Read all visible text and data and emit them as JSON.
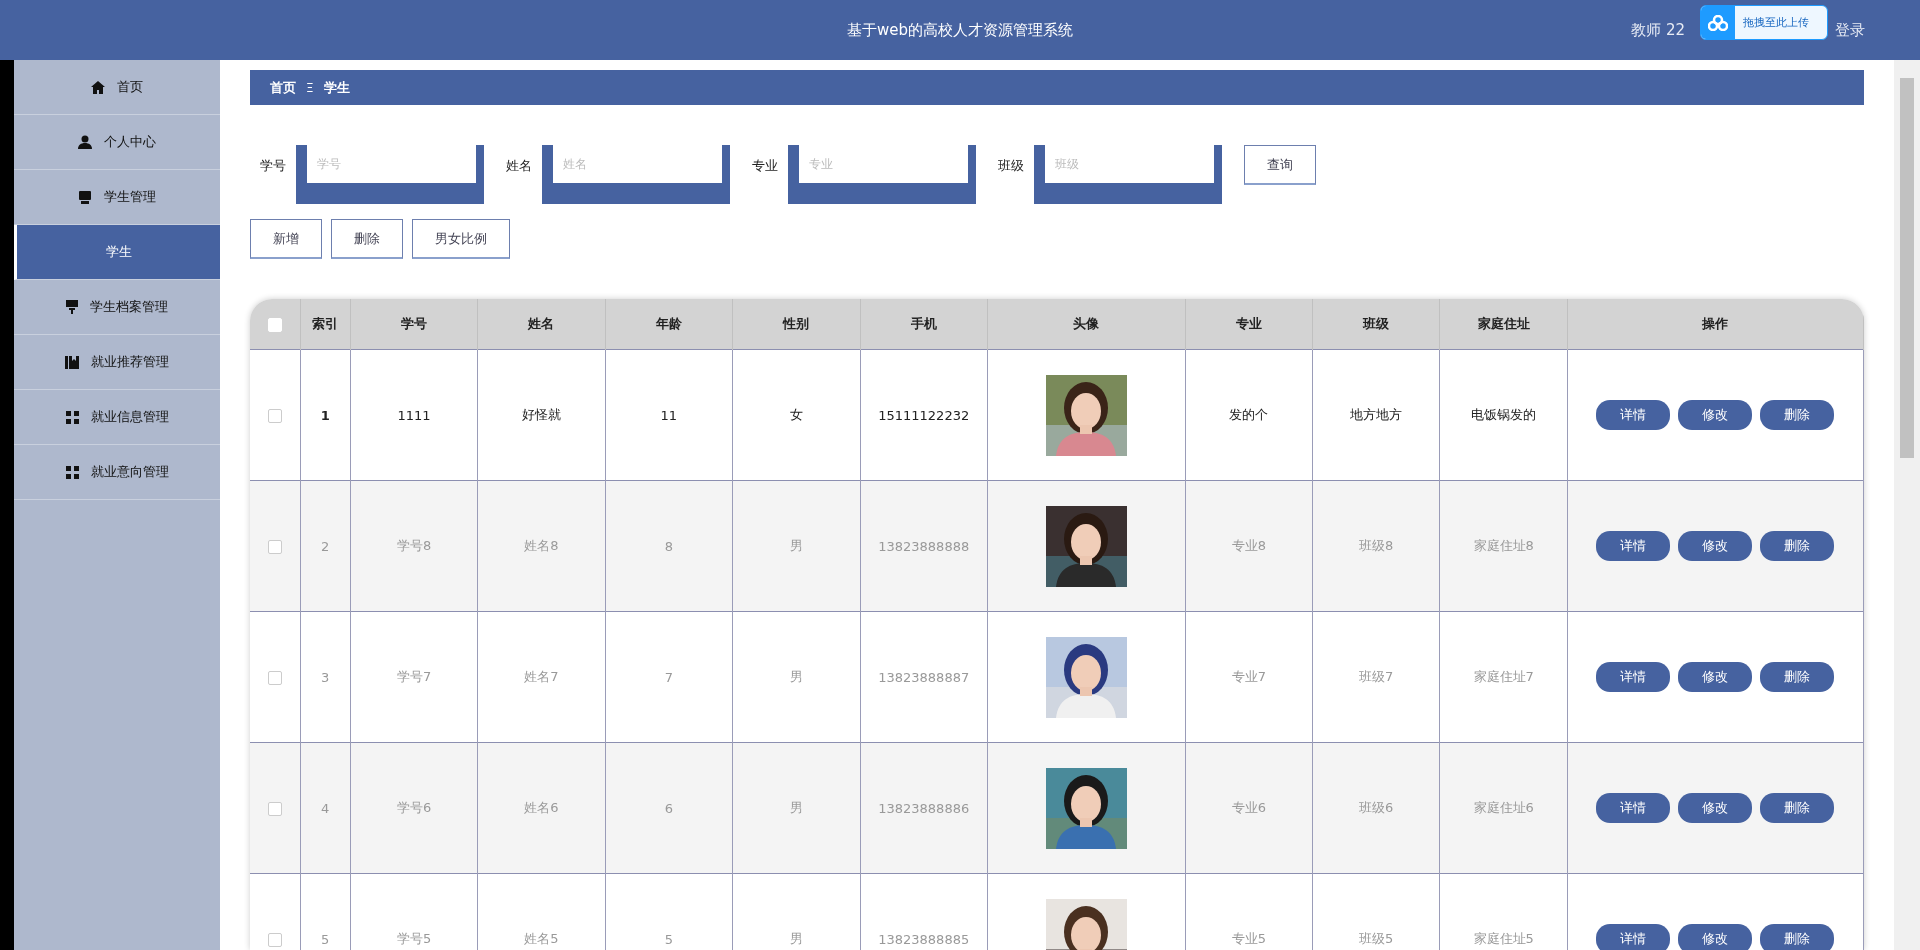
{
  "header": {
    "title": "基于web的高校人才资源管理系统",
    "user": "教师 22",
    "logout": "登录",
    "upload_overlay": "拖拽至此上传"
  },
  "sidebar": {
    "items": [
      {
        "label": "首页",
        "selected": false
      },
      {
        "label": "个人中心",
        "selected": false
      },
      {
        "label": "学生管理",
        "selected": false
      },
      {
        "label": "学生",
        "selected": true
      },
      {
        "label": "学生档案管理",
        "selected": false
      },
      {
        "label": "就业推荐管理",
        "selected": false
      },
      {
        "label": "就业信息管理",
        "selected": false
      },
      {
        "label": "就业意向管理",
        "selected": false
      }
    ]
  },
  "breadcrumb": {
    "items": [
      "首页",
      "学生"
    ],
    "separator": "Ξ"
  },
  "search": {
    "fields": [
      {
        "label": "学号",
        "placeholder": "学号"
      },
      {
        "label": "姓名",
        "placeholder": "姓名"
      },
      {
        "label": "专业",
        "placeholder": "专业"
      },
      {
        "label": "班级",
        "placeholder": "班级"
      }
    ],
    "button": "查询"
  },
  "actions": [
    "新增",
    "删除",
    "男女比例"
  ],
  "table": {
    "select_all": {
      "checked": false
    },
    "columns": [
      "索引",
      "学号",
      "姓名",
      "年龄",
      "性别",
      "手机",
      "头像",
      "专业",
      "班级",
      "家庭住址",
      "操作"
    ],
    "rows": [
      {
        "checked": false,
        "hovered": true,
        "cells": [
          "1",
          "1111",
          "好怪就",
          "11",
          "女",
          "15111122232"
        ],
        "tail": [
          "发的个",
          "地方地方",
          "电饭锅发的"
        ],
        "buttons": [
          "详情",
          "修改",
          "删除"
        ]
      },
      {
        "checked": false,
        "hovered": false,
        "cells": [
          "2",
          "学号8",
          "姓名8",
          "8",
          "男",
          "13823888888"
        ],
        "tail": [
          "专业8",
          "班级8",
          "家庭住址8"
        ],
        "buttons": [
          "详情",
          "修改",
          "删除"
        ]
      },
      {
        "checked": false,
        "hovered": false,
        "cells": [
          "3",
          "学号7",
          "姓名7",
          "7",
          "男",
          "13823888887"
        ],
        "tail": [
          "专业7",
          "班级7",
          "家庭住址7"
        ],
        "buttons": [
          "详情",
          "修改",
          "删除"
        ]
      },
      {
        "checked": false,
        "hovered": false,
        "cells": [
          "4",
          "学号6",
          "姓名6",
          "6",
          "男",
          "13823888886"
        ],
        "tail": [
          "专业6",
          "班级6",
          "家庭住址6"
        ],
        "buttons": [
          "详情",
          "修改",
          "删除"
        ]
      },
      {
        "checked": false,
        "hovered": false,
        "cells": [
          "5",
          "学号5",
          "姓名5",
          "5",
          "男",
          "13823888885"
        ],
        "tail": [
          "专业5",
          "班级5",
          "家庭住址5"
        ],
        "buttons": [
          "详情",
          "修改",
          "删除"
        ]
      }
    ]
  }
}
